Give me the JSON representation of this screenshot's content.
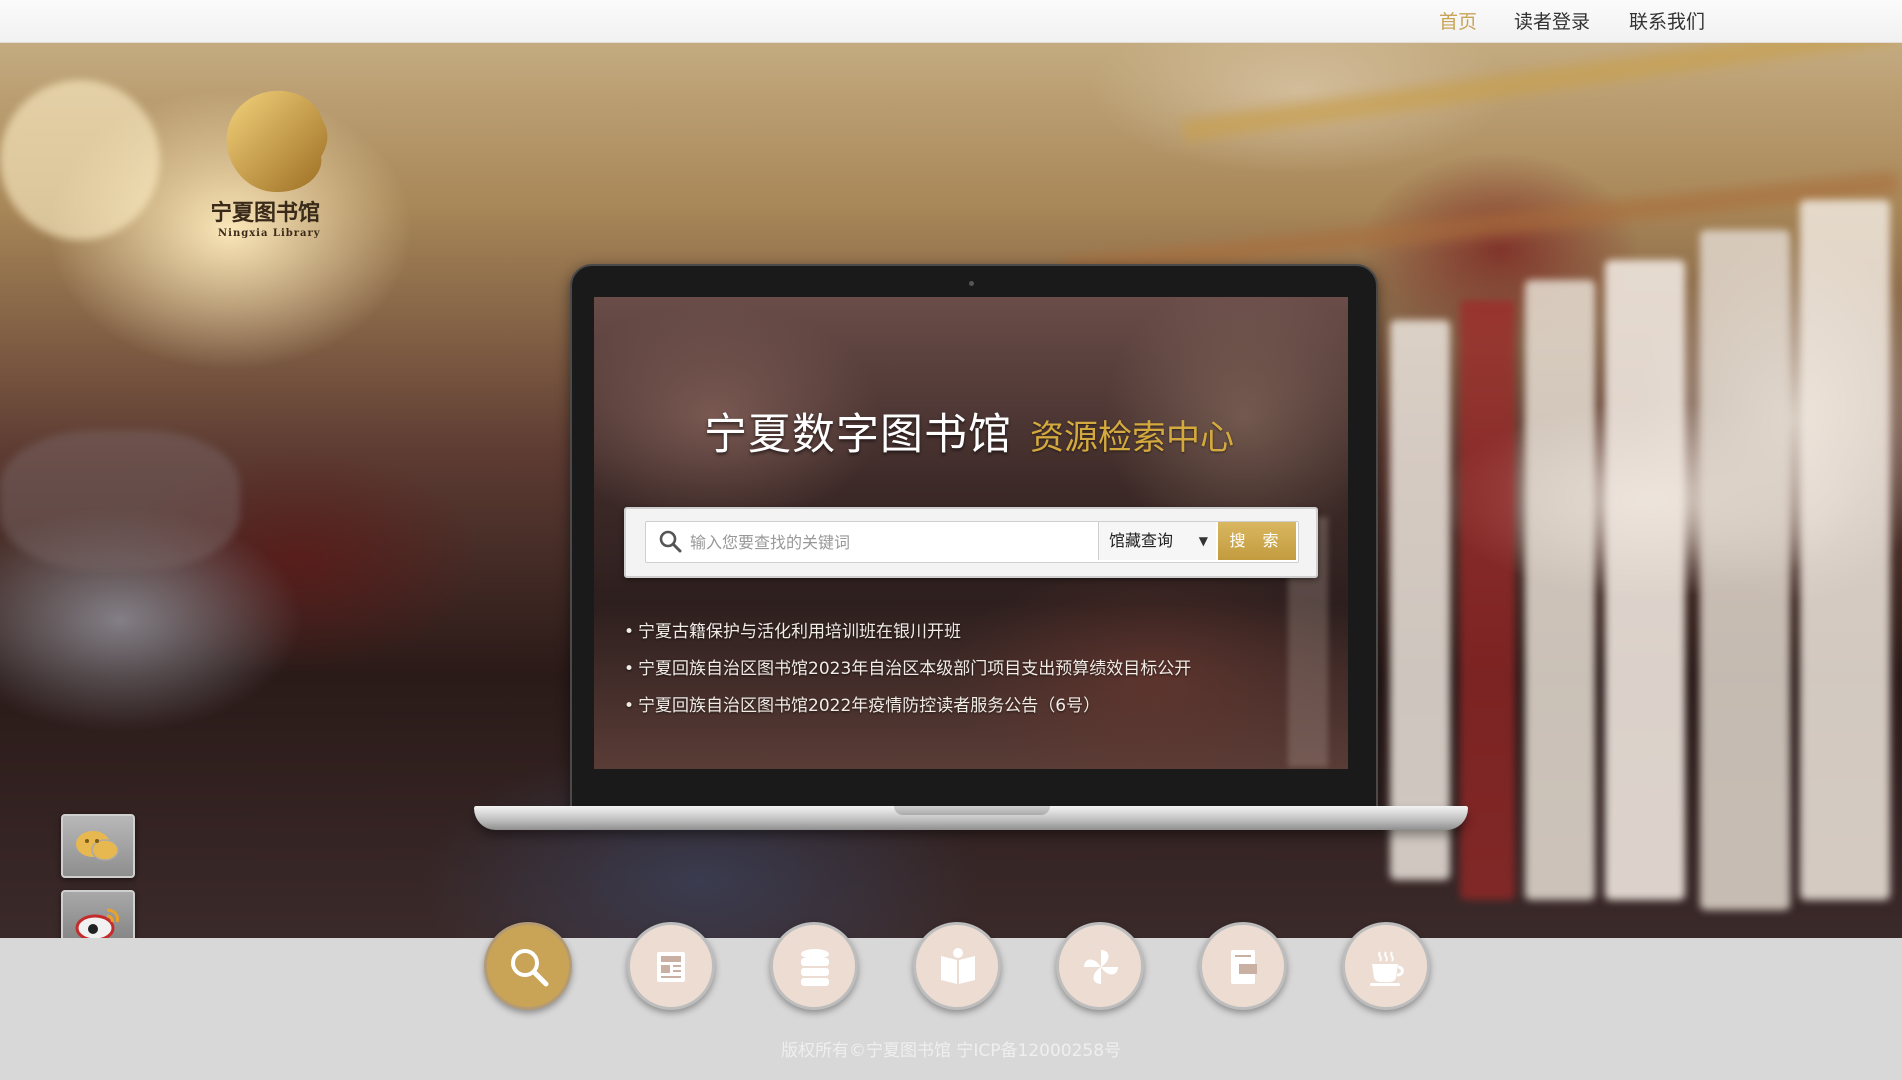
{
  "topnav": {
    "items": [
      {
        "label": "首页",
        "active": true
      },
      {
        "label": "读者登录",
        "active": false
      },
      {
        "label": "联系我们",
        "active": false
      }
    ]
  },
  "logo": {
    "name_cn": "宁夏图书馆",
    "name_en": "Ningxia Library"
  },
  "hero": {
    "title": "宁夏数字图书馆",
    "subtitle": "资源检索中心"
  },
  "search": {
    "placeholder": "输入您要查找的关键词",
    "scope_selected": "馆藏查询",
    "button_label": "搜 索"
  },
  "news": [
    "宁夏古籍保护与活化利用培训班在银川开班",
    "宁夏回族自治区图书馆2023年自治区本级部门项目支出预算绩效目标公开",
    "宁夏回族自治区图书馆2022年疫情防控读者服务公告（6号）"
  ],
  "side_buttons": [
    "wechat-icon",
    "weibo-icon",
    "mobile-icon"
  ],
  "bottom_icons": [
    "search-icon",
    "newspaper-icon",
    "database-icon",
    "open-book-icon",
    "pinwheel-icon",
    "new-book-icon",
    "coffee-cup-icon"
  ],
  "colors": {
    "accent": "#c9a457",
    "subtitle_gold": "#d4aa3e"
  },
  "footer": {
    "copyright": "版权所有©宁夏图书馆 宁ICP备12000258号"
  }
}
